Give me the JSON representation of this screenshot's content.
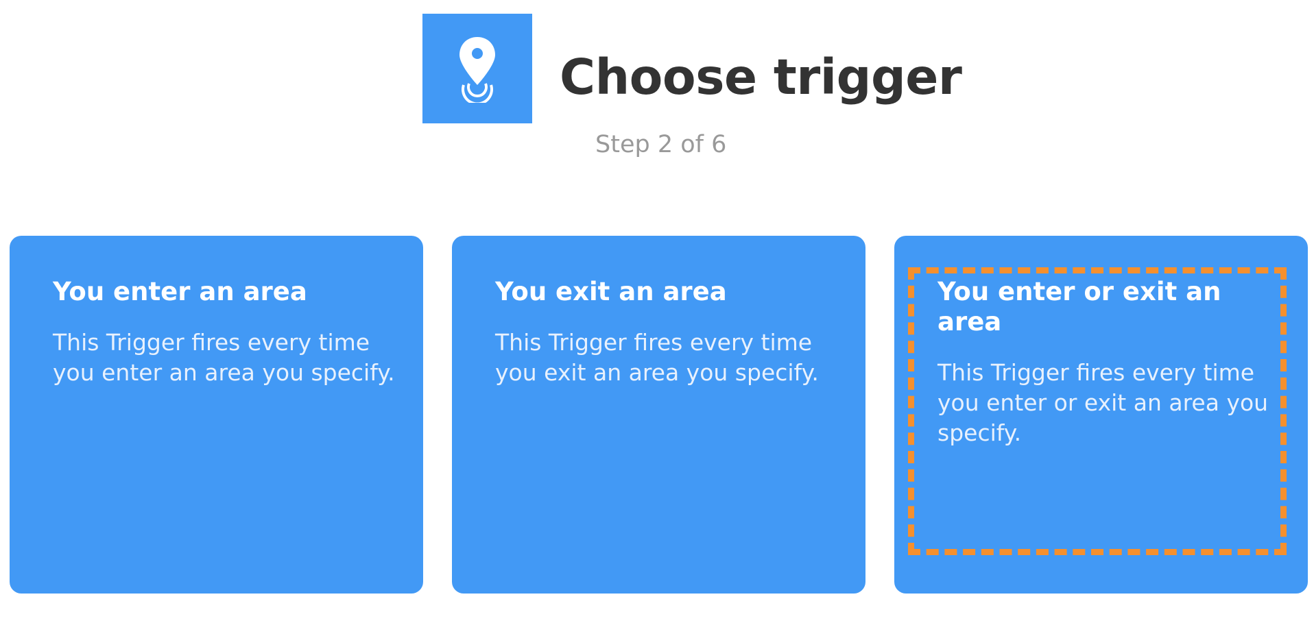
{
  "header": {
    "icon": "location-pin-icon",
    "icon_bg_color": "#4299f5",
    "title": "Choose trigger",
    "step": "Step 2 of 6"
  },
  "triggers": [
    {
      "title": "You enter an area",
      "description": "This Trigger fires every time you enter an area you specify."
    },
    {
      "title": "You exit an area",
      "description": "This Trigger fires every time you exit an area you specify."
    },
    {
      "title": "You enter or exit an area",
      "description": "This Trigger fires every time you enter or exit an area you specify."
    }
  ],
  "colors": {
    "card_bg": "#4299f5",
    "highlight_border": "#f5902e",
    "title_text": "#333333",
    "step_text": "#999999"
  }
}
